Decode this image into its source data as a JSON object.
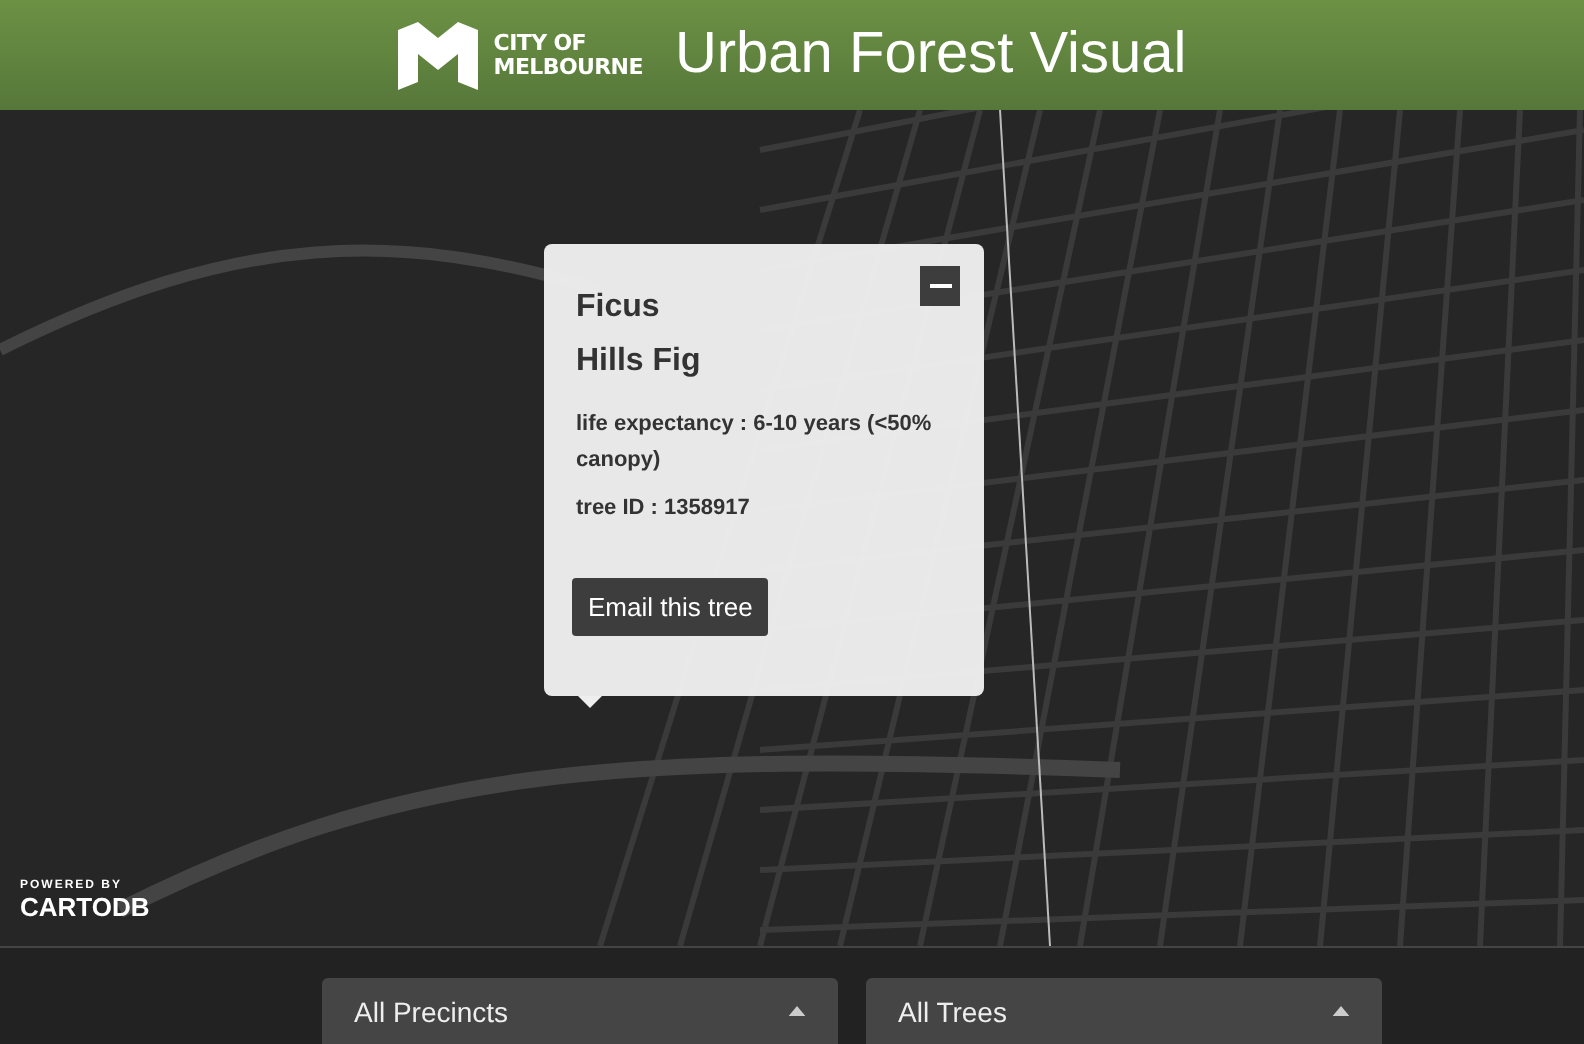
{
  "header": {
    "logo_lines": [
      "CITY OF",
      "MELBOURNE"
    ],
    "title": "Urban Forest Visual"
  },
  "map": {
    "attribution": {
      "caption": "POWERED BY",
      "brand": "CARTODB"
    }
  },
  "popup": {
    "title_lines": [
      "Ficus",
      "Hills Fig"
    ],
    "details": [
      "life expectancy : 6-10 years (<50% canopy)",
      "tree ID : 1358917"
    ],
    "button": "Email this tree"
  },
  "filters": [
    {
      "value": "All Precincts"
    },
    {
      "value": "All Trees"
    }
  ]
}
